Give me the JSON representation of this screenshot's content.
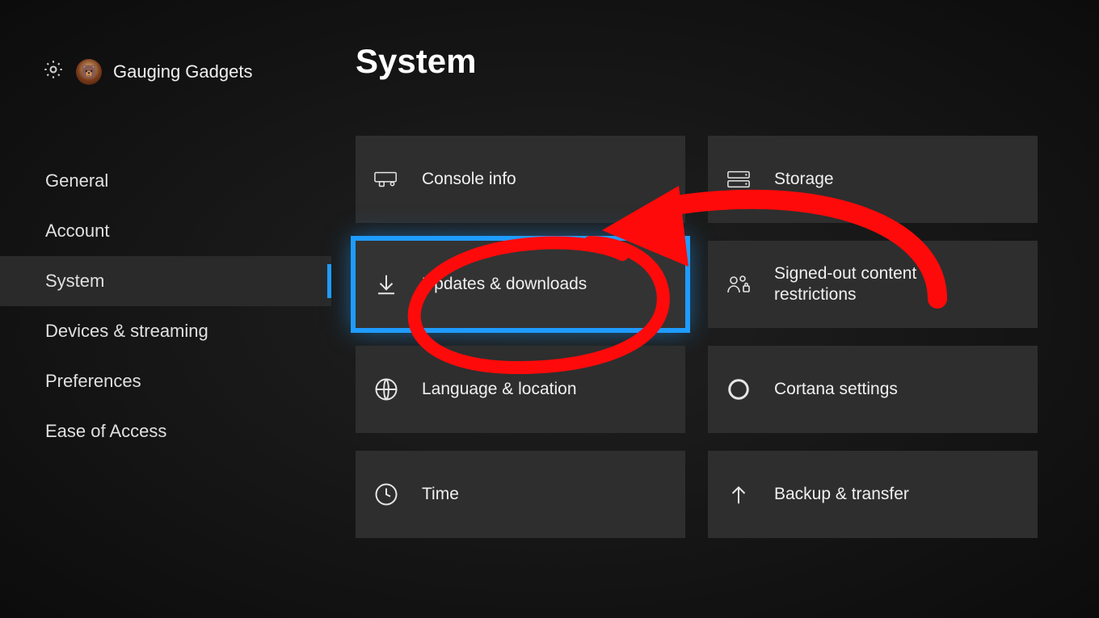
{
  "profile": {
    "name": "Gauging Gadgets"
  },
  "sidebar": {
    "items": [
      {
        "label": "General"
      },
      {
        "label": "Account"
      },
      {
        "label": "System"
      },
      {
        "label": "Devices & streaming"
      },
      {
        "label": "Preferences"
      },
      {
        "label": "Ease of Access"
      }
    ],
    "active_index": 2
  },
  "main": {
    "title": "System",
    "tiles_col1": [
      {
        "label": "Console info"
      },
      {
        "label": "Updates & downloads"
      },
      {
        "label": "Language & location"
      },
      {
        "label": "Time"
      }
    ],
    "tiles_col2": [
      {
        "label": "Storage"
      },
      {
        "label": "Signed-out content restrictions"
      },
      {
        "label": "Cortana settings"
      },
      {
        "label": "Backup & transfer"
      }
    ],
    "selected": "Updates & downloads"
  },
  "colors": {
    "accent": "#1f9cff",
    "annotation": "#ff0a0a"
  }
}
